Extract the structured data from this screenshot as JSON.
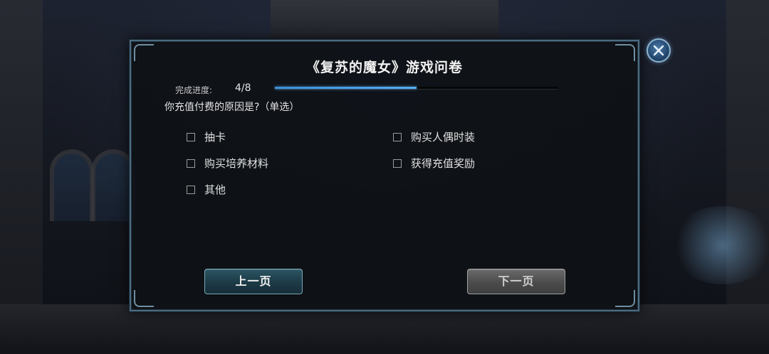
{
  "survey": {
    "title": "《复苏的魔女》游戏问卷",
    "progress_label": "完成进度:",
    "progress_text": "4/8",
    "progress_fraction": 0.5,
    "question": "你充值付费的原因是?（单选）",
    "options": [
      {
        "label": "抽卡",
        "checked": false
      },
      {
        "label": "购买人偶时装",
        "checked": false
      },
      {
        "label": "购买培养材料",
        "checked": false
      },
      {
        "label": "获得充值奖励",
        "checked": false
      },
      {
        "label": "其他",
        "checked": false
      }
    ],
    "prev_label": "上一页",
    "next_label": "下一页"
  },
  "close_icon": "close-x-icon",
  "colors": {
    "accent_progress": "#4a9fe6",
    "prev_button": "#1f3f4b",
    "next_button": "#555555"
  }
}
